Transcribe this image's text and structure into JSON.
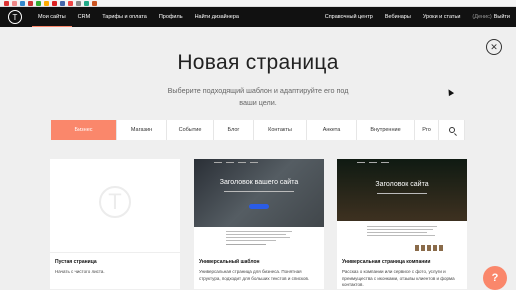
{
  "colors": {
    "accent": "#fa876b",
    "nav_bg": "#111111",
    "page_bg": "#efefef",
    "hero_button": "#2b5ce6"
  },
  "topnav": {
    "logo_icon": "tilda-logo",
    "left_items": [
      "Мои сайты",
      "CRM",
      "Тарифы и оплата",
      "Профиль",
      "Найти дизайнера"
    ],
    "active_index": 0,
    "right_items": [
      "Справочный центр",
      "Вебинары",
      "Уроки и статьи"
    ],
    "user": "(Денис)",
    "logout": "Выйти"
  },
  "modal": {
    "title": "Новая страница",
    "subtitle": "Выберите подходящий шаблон и адаптируйте его под ваши цели.",
    "close_icon": "close-icon"
  },
  "tabs": {
    "items": [
      "Бизнес",
      "Магазин",
      "Событие",
      "Блог",
      "Контакты",
      "Анкета",
      "Внутренние",
      "Pro"
    ],
    "active_index": 0,
    "search_icon": "search-icon"
  },
  "cards": [
    {
      "title": "Пустая страница",
      "desc": "Начать с чистого листа."
    },
    {
      "title": "Универсальный шаблон",
      "hero": "Заголовок вашего сайта",
      "desc": "Универсальная страница для бизнеса. Понятная структура, подходит для больших текстов и списков."
    },
    {
      "title": "Универсальная страница компании",
      "hero": "Заголовок сайта",
      "desc": "Рассказ о компании или сервисе с фото, услуги и преимущества с иконками, отзывы клиентов и форма контактов."
    }
  ],
  "fab": {
    "icon": "help-icon",
    "label": "?"
  }
}
